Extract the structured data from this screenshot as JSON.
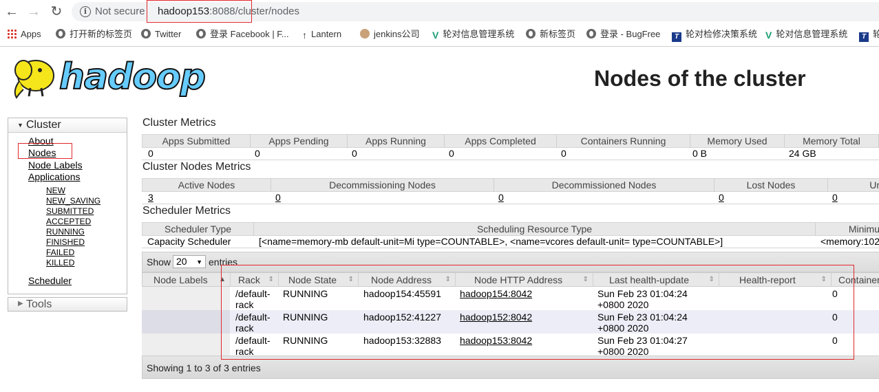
{
  "browser": {
    "security_label": "Not secure",
    "url_host": "hadoop153",
    "url_port": ":8088",
    "url_path": "/cluster/nodes",
    "bookmarks": [
      {
        "label": "Apps",
        "icon": "apps-grid-icon"
      },
      {
        "label": "打开新的标签页",
        "icon": "globe-icon"
      },
      {
        "label": "Twitter",
        "icon": "globe-icon"
      },
      {
        "label": "登录 Facebook | F...",
        "icon": "globe-icon"
      },
      {
        "label": "Lantern",
        "icon": "up-arrow-icon"
      },
      {
        "label": "jenkins公司",
        "icon": "jenkins-icon"
      },
      {
        "label": "轮对信息管理系统",
        "icon": "v-logo-icon"
      },
      {
        "label": "新标签页",
        "icon": "globe-icon"
      },
      {
        "label": "登录 - BugFree",
        "icon": "globe-icon"
      },
      {
        "label": "轮对检修决策系统",
        "icon": "t-logo-icon"
      },
      {
        "label": "轮对信息管理系统",
        "icon": "v-logo-icon"
      },
      {
        "label": "轮",
        "icon": "t-logo-icon"
      }
    ]
  },
  "header": {
    "logo_text": "hadoop",
    "title": "Nodes of the cluster"
  },
  "sidebar": {
    "cluster_label": "Cluster",
    "links": {
      "about": "About",
      "nodes": "Nodes",
      "node_labels": "Node Labels",
      "applications": "Applications",
      "scheduler": "Scheduler"
    },
    "app_states": [
      "NEW",
      "NEW_SAVING",
      "SUBMITTED",
      "ACCEPTED",
      "RUNNING",
      "FINISHED",
      "FAILED",
      "KILLED"
    ],
    "tools_label": "Tools"
  },
  "cluster_metrics": {
    "title": "Cluster Metrics",
    "headers": [
      "Apps Submitted",
      "Apps Pending",
      "Apps Running",
      "Apps Completed",
      "Containers Running",
      "Memory Used",
      "Memory Total"
    ],
    "values": [
      "0",
      "0",
      "0",
      "0",
      "0",
      "0 B",
      "24 GB"
    ]
  },
  "cluster_nodes_metrics": {
    "title": "Cluster Nodes Metrics",
    "headers": [
      "Active Nodes",
      "Decommissioning Nodes",
      "Decommissioned Nodes",
      "Lost Nodes",
      "Ur"
    ],
    "values": [
      "3",
      "0",
      "0",
      "0",
      "0"
    ]
  },
  "scheduler_metrics": {
    "title": "Scheduler Metrics",
    "headers": [
      "Scheduler Type",
      "Scheduling Resource Type",
      "Minimu"
    ],
    "values": [
      "Capacity Scheduler",
      "[<name=memory-mb default-unit=Mi type=COUNTABLE>, <name=vcores default-unit= type=COUNTABLE>]",
      "<memory:102"
    ]
  },
  "nodes_table": {
    "show_label": "Show",
    "page_size": "20",
    "entries_label": "entries",
    "columns": [
      "Node Labels",
      "Rack",
      "Node State",
      "Node Address",
      "Node HTTP Address",
      "Last health-update",
      "Health-report",
      "Container"
    ],
    "rows": [
      {
        "rack_1": "/default-",
        "rack_2": "rack",
        "state": "RUNNING",
        "address": "hadoop154:45591",
        "http": "hadoop154:8042",
        "update_1": "Sun Feb 23 01:04:24",
        "update_2": "+0800 2020",
        "containers": "0"
      },
      {
        "rack_1": "/default-",
        "rack_2": "rack",
        "state": "RUNNING",
        "address": "hadoop152:41227",
        "http": "hadoop152:8042",
        "update_1": "Sun Feb 23 01:04:24",
        "update_2": "+0800 2020",
        "containers": "0"
      },
      {
        "rack_1": "/default-",
        "rack_2": "rack",
        "state": "RUNNING",
        "address": "hadoop153:32883",
        "http": "hadoop153:8042",
        "update_1": "Sun Feb 23 01:04:27",
        "update_2": "+0800 2020",
        "containers": "0"
      }
    ],
    "footer": "Showing 1 to 3 of 3 entries"
  },
  "colors": {
    "highlight": "#e0262c",
    "logo_yellow": "#f5e51b",
    "logo_blue": "#66ccff",
    "row_selected": "#e6e8f0",
    "row_alt": "#ededf7"
  }
}
